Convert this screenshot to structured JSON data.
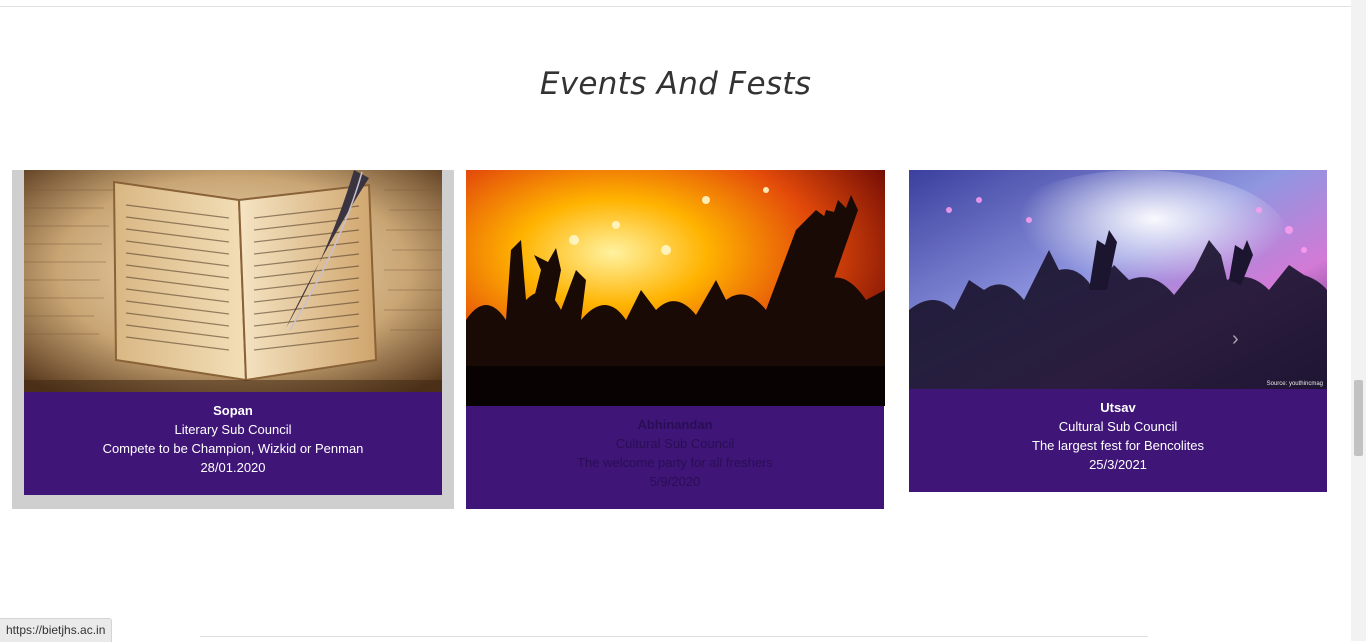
{
  "section": {
    "title": "Events And Fests"
  },
  "cards": [
    {
      "name": "Sopan",
      "council": "Literary Sub Council",
      "description": "Compete to be Champion, Wizkid or Penman",
      "date": "28/01.2020",
      "image": "old-book-quill"
    },
    {
      "name": "Abhinandan",
      "council": "Cultural Sub Council",
      "description": "The welcome party for all freshers",
      "date": "5/9/2020",
      "image": "concert-crowd-orange"
    },
    {
      "name": "Utsav",
      "council": "Cultural Sub Council",
      "description": "The largest fest for Bencolites",
      "date": "25/3/2021",
      "image": "concert-crowd-blue",
      "image_caption": "Source: youthincmag"
    }
  ],
  "status_bar": {
    "url": "https://bietjhs.ac.in"
  },
  "colors": {
    "card_body": "#3f1578",
    "title_text": "#333333"
  },
  "icons": {
    "next_arrow": "chevron-right-icon"
  }
}
